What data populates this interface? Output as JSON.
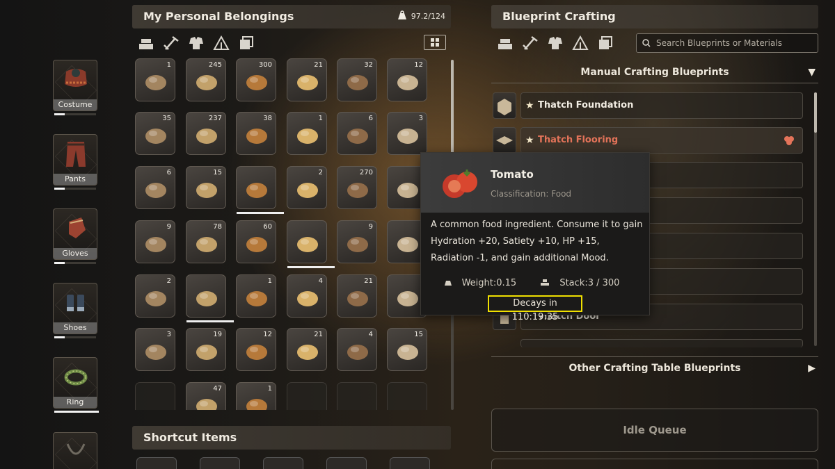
{
  "belongings": {
    "title": "My Personal Belongings",
    "weight": "97.2/124",
    "tabs": [
      "materials-icon",
      "tools-icon",
      "outfit-icon",
      "camp-icon",
      "misc-icon"
    ]
  },
  "equipment": [
    {
      "label": "Costume"
    },
    {
      "label": "Pants"
    },
    {
      "label": "Gloves"
    },
    {
      "label": "Shoes"
    },
    {
      "label": "Ring"
    }
  ],
  "grid": [
    [
      "1",
      "245",
      "300",
      "21",
      "32",
      "12"
    ],
    [
      "35",
      "237",
      "38",
      "1",
      "6",
      "3"
    ],
    [
      "6",
      "15",
      "",
      "2",
      "270",
      ""
    ],
    [
      "9",
      "78",
      "60",
      "",
      "9",
      ""
    ],
    [
      "2",
      "",
      "1",
      "4",
      "21",
      ""
    ],
    [
      "3",
      "19",
      "12",
      "21",
      "4",
      "15"
    ],
    [
      "",
      "47",
      "1",
      "",
      "",
      ""
    ]
  ],
  "shortcut": {
    "title": "Shortcut Items"
  },
  "blueprint": {
    "title": "Blueprint Crafting",
    "search_placeholder": "Search Blueprints or Materials",
    "manual_header": "Manual Crafting Blueprints",
    "other_header": "Other Crafting Table Blueprints",
    "rows": [
      "Thatch Foundation",
      "Thatch Flooring",
      "",
      "",
      "",
      "",
      "Thatch Door"
    ],
    "idle": "Idle Queue"
  },
  "tooltip": {
    "name": "Tomato",
    "classification": "Classification: Food",
    "description": "A common food ingredient. Consume it to gain Hydration +20, Satiety +10, HP +15, Radiation -1, and gain additional Mood.",
    "weight": "Weight:0.15",
    "stack": "Stack:3 / 300",
    "decay": "Decays in 110:19:35"
  },
  "colors": {
    "accent_red": "#e4745a",
    "highlight": "#f0e000"
  }
}
